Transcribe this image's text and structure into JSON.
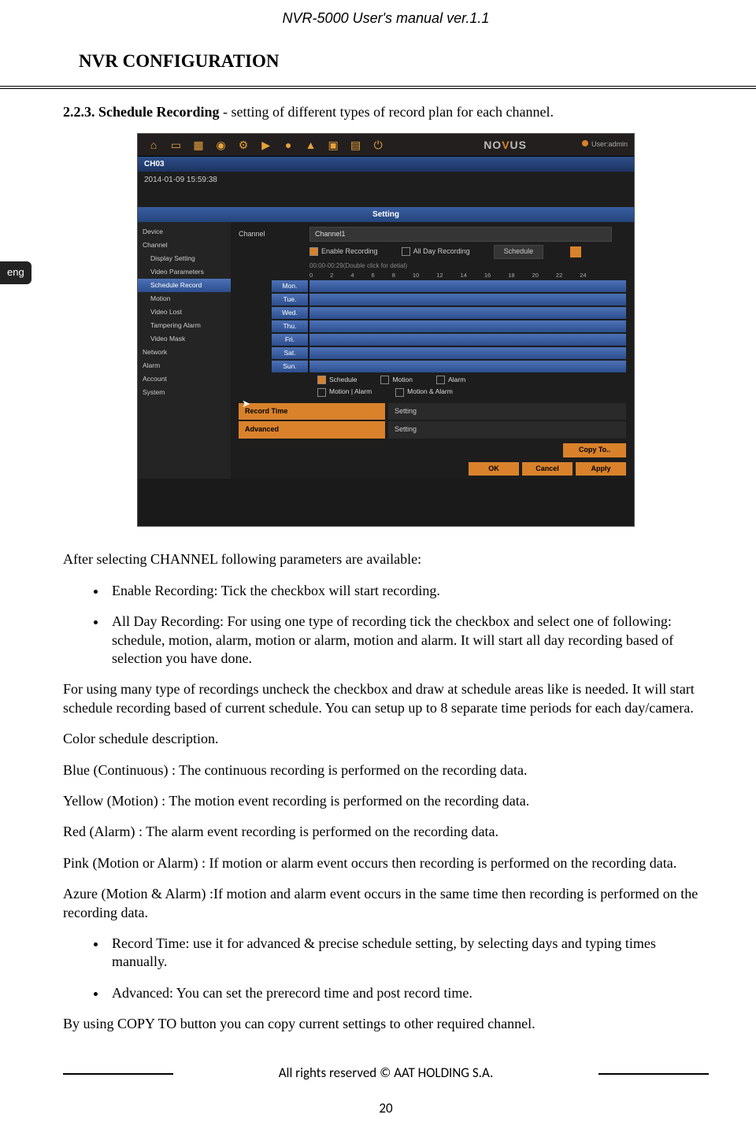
{
  "header": "NVR-5000 User's manual ver.1.1",
  "section_title": "NVR CONFIGURATION",
  "intro_bold": "2.2.3. Schedule Recording",
  "intro_rest": " - setting of different types of record plan for each channel.",
  "lang_tab": "eng",
  "shot": {
    "topbar_icons": [
      "home-icon",
      "monitor-icon",
      "quad-icon",
      "bear-icon",
      "gear-icon",
      "play-icon",
      "rec-icon",
      "warning-icon",
      "camera-icon",
      "folder-icon",
      "power-icon"
    ],
    "brand_pre": "NO",
    "brand_accent": "V",
    "brand_post": "US",
    "user": "User:admin",
    "ch": "CH03",
    "timestamp": "2014-01-09 15:59:38",
    "setting_header": "Setting",
    "sidebar": [
      {
        "label": "Device",
        "sub": false,
        "sel": false
      },
      {
        "label": "Channel",
        "sub": false,
        "sel": false
      },
      {
        "label": "Display Setting",
        "sub": true,
        "sel": false
      },
      {
        "label": "Video Parameters",
        "sub": true,
        "sel": false
      },
      {
        "label": "Schedule Record",
        "sub": true,
        "sel": true
      },
      {
        "label": "Motion",
        "sub": true,
        "sel": false
      },
      {
        "label": "Video Lost",
        "sub": true,
        "sel": false
      },
      {
        "label": "Tampering Alarm",
        "sub": true,
        "sel": false
      },
      {
        "label": "Video Mask",
        "sub": true,
        "sel": false
      },
      {
        "label": "Network",
        "sub": false,
        "sel": false
      },
      {
        "label": "Alarm",
        "sub": false,
        "sel": false
      },
      {
        "label": "Account",
        "sub": false,
        "sel": false
      },
      {
        "label": "System",
        "sub": false,
        "sel": false
      }
    ],
    "panel": {
      "channel_lab": "Channel",
      "channel_val": "Channel1",
      "enable_lab": "Enable Recording",
      "allday_lab": "All Day Recording",
      "allday_mode": "Schedule",
      "hint": "00:00-00:29(Double click for detial)",
      "ticks": [
        "0",
        "2",
        "4",
        "6",
        "8",
        "10",
        "12",
        "14",
        "16",
        "18",
        "20",
        "22",
        "24"
      ],
      "days": [
        "Mon.",
        "Tue.",
        "Wed.",
        "Thu.",
        "Fri.",
        "Sat.",
        "Sun."
      ],
      "legend": [
        "Schedule",
        "Motion",
        "Alarm",
        "Motion | Alarm",
        "Motion & Alarm"
      ],
      "record_time_lab": "Record Time",
      "record_time_val": "Setting",
      "advanced_lab": "Advanced",
      "advanced_val": "Setting",
      "copy_btn": "Copy To..",
      "ok_btn": "OK",
      "cancel_btn": "Cancel",
      "apply_btn": "Apply"
    }
  },
  "body": {
    "p1": "After selecting CHANNEL following parameters are available:",
    "li1": "Enable Recording: Tick the checkbox will start recording.",
    "li2": "All Day Recording:  For using one type of recording tick the checkbox and select one of following: schedule, motion, alarm, motion or alarm, motion and alarm. It will start all day recording based of selection you have done.",
    "p2": "For using many type of recordings uncheck the checkbox and draw at schedule areas like is needed. It will start schedule recording based of current schedule. You can setup up to 8 separate time periods for each day/camera.",
    "p3": "Color schedule description.",
    "p4": "Blue (Continuous) : The continuous recording is performed on the recording data.",
    "p5": "Yellow (Motion) : The motion event recording is performed on the recording data.",
    "p6": "Red (Alarm) : The alarm event recording is performed on the recording data.",
    "p7": "Pink (Motion or Alarm) : If motion or alarm event occurs then recording is performed on the recording data.",
    "p8": "Azure (Motion & Alarm) :If motion and alarm event occurs in the same time then recording is performed on the recording data.",
    "li3": "Record Time: use it for advanced & precise schedule setting, by selecting days and typing times manually.",
    "li4": "Advanced: You can set the prerecord time and post record time.",
    "p9": "By using COPY TO button you can copy current settings to other required channel."
  },
  "footer": "All rights reserved © AAT HOLDING S.A.",
  "page_number": "20"
}
